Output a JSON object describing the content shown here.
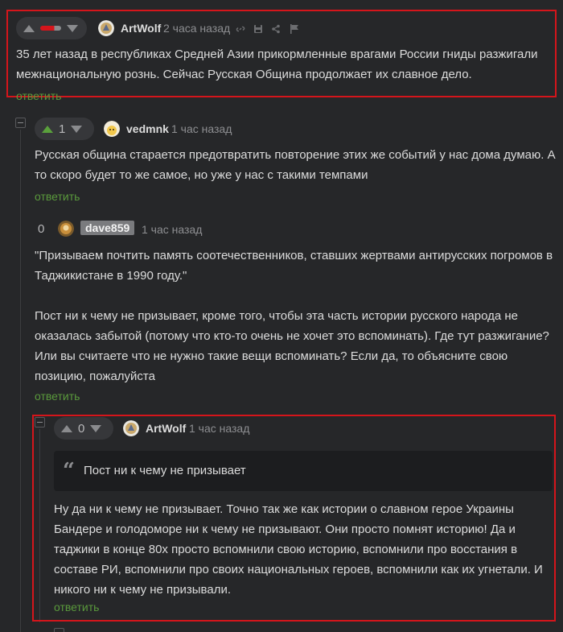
{
  "comments": [
    {
      "author": "ArtWolf",
      "time": "2 часа назад",
      "vote": "",
      "text": "35 лет назад в республиках Средней Азии прикормленные врагами России гниды разжигали\nмежнациональную рознь. Сейчас Русская Община продолжает их славное дело.",
      "reply": "ответить"
    },
    {
      "author": "vedmnk",
      "time": "1 час назад",
      "vote": "1",
      "text": "Русская община старается предотвратить повторение этих же событий у нас дома думаю. А\nто скоро будет то же самое, но уже у нас с такими темпами",
      "reply": "ответить"
    },
    {
      "author": "dave859",
      "time": "1 час назад",
      "vote": "0",
      "text": "\"Призываем почтить память соотечественников, ставших жертвами антирусских погромов в\nТаджикистане в 1990 году.\"\n\nПост ни к чему не призывает, кроме того, чтобы эта часть истории русского народа не\nоказалась забытой (потому что кто-то очень не хочет это вспоминать). Где тут разжигание?\nИли вы считаете что не нужно такие вещи вспоминать? Если да, то объясните свою\nпозицию, пожалуйста",
      "reply": "ответить"
    },
    {
      "author": "ArtWolf",
      "time": "1 час назад",
      "vote": "0",
      "quote": "Пост ни к чему не призывает",
      "text": "Ну да ни к чему не призывает. Точно так же как истории о славном герое Украины\nБандере и голодоморе ни к чему не призывают. Они просто помнят историю! Да и\nтаджики в конце 80х просто вспомнили свою историю, вспомнили про восстания в\nсоставе РИ, вспомнили про своих национальных героев, вспомнили как их угнетали. И\nникого ни к чему не призывали.",
      "reply": "ответить"
    }
  ],
  "colors": {
    "accent_green": "#5a9a3c",
    "highlight_red": "#d5151b",
    "background": "#262729"
  },
  "icons": [
    "link-icon",
    "save-icon",
    "share-icon",
    "flag-icon",
    "quote-icon"
  ]
}
